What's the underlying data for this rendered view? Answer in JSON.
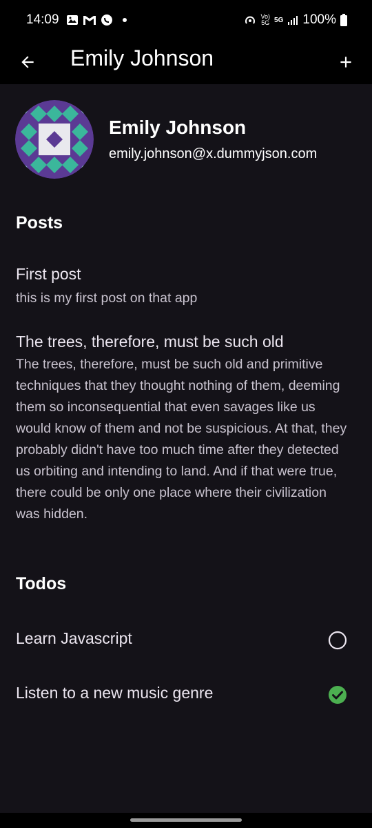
{
  "status_bar": {
    "time": "14:09",
    "battery": "100%",
    "network_volte": "Vo) 5G",
    "network_5g": "5G"
  },
  "app_bar": {
    "title": "Emily Johnson",
    "back_icon": "arrow-back-icon",
    "add_icon": "add-icon"
  },
  "user": {
    "name": "Emily Johnson",
    "email": "emily.johnson@x.dummyjson.com"
  },
  "posts": {
    "heading": "Posts",
    "items": [
      {
        "title": "First post",
        "body": "this is my first post on that app"
      },
      {
        "title": "The trees, therefore, must be such old",
        "body": "The trees, therefore, must be such old and primitive techniques that they thought nothing of them, deeming them so inconsequential that even savages like us would know of them and not be suspicious. At that, they probably didn't have too much time after they detected us orbiting and intending to land. And if that were true, there could be only one place where their civilization was hidden."
      }
    ]
  },
  "todos": {
    "heading": "Todos",
    "items": [
      {
        "label": "Learn Javascript",
        "completed": false
      },
      {
        "label": "Listen to a new music genre",
        "completed": true
      }
    ]
  },
  "colors": {
    "background": "#141218",
    "check_green": "#4CAF50",
    "avatar_purple": "#5B3A94",
    "avatar_teal": "#3BB79B"
  }
}
